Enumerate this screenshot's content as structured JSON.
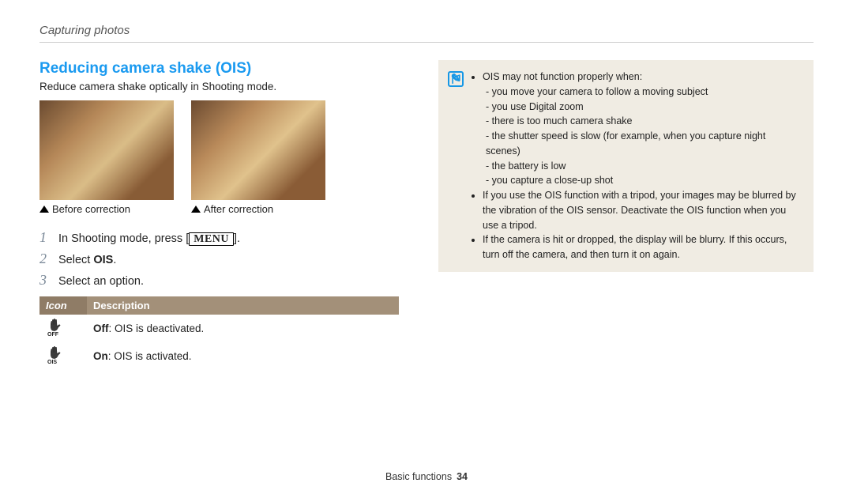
{
  "breadcrumb": "Capturing photos",
  "heading": "Reducing camera shake (OIS)",
  "subtext": "Reduce camera shake optically in Shooting mode.",
  "captions": {
    "before": "Before correction",
    "after": "After correction"
  },
  "steps": {
    "s1a": "In Shooting mode, press [",
    "s1_menu": "MENU",
    "s1b": "].",
    "s2a": "Select ",
    "s2b": "OIS",
    "s2c": ".",
    "s3": "Select an option."
  },
  "table": {
    "head_icon": "Icon",
    "head_desc": "Description",
    "rows": [
      {
        "icon": "off",
        "label": "Off",
        "desc": ": OIS is deactivated."
      },
      {
        "icon": "on",
        "label": "On",
        "desc": ": OIS is activated."
      }
    ]
  },
  "note": {
    "b1": "OIS may not function properly when:",
    "sub": [
      "you move your camera to follow a moving subject",
      "you use Digital zoom",
      "there is too much camera shake",
      "the shutter speed is slow (for example, when you capture night scenes)",
      "the battery is low",
      "you capture a close-up shot"
    ],
    "b2": "If you use the OIS function with a tripod, your images may be blurred by the vibration of the OIS sensor. Deactivate the OIS function when you use a tripod.",
    "b3": "If the camera is hit or dropped, the display will be blurry. If this occurs, turn off the camera, and then turn it on again."
  },
  "footer": {
    "section": "Basic functions",
    "page": "34"
  }
}
